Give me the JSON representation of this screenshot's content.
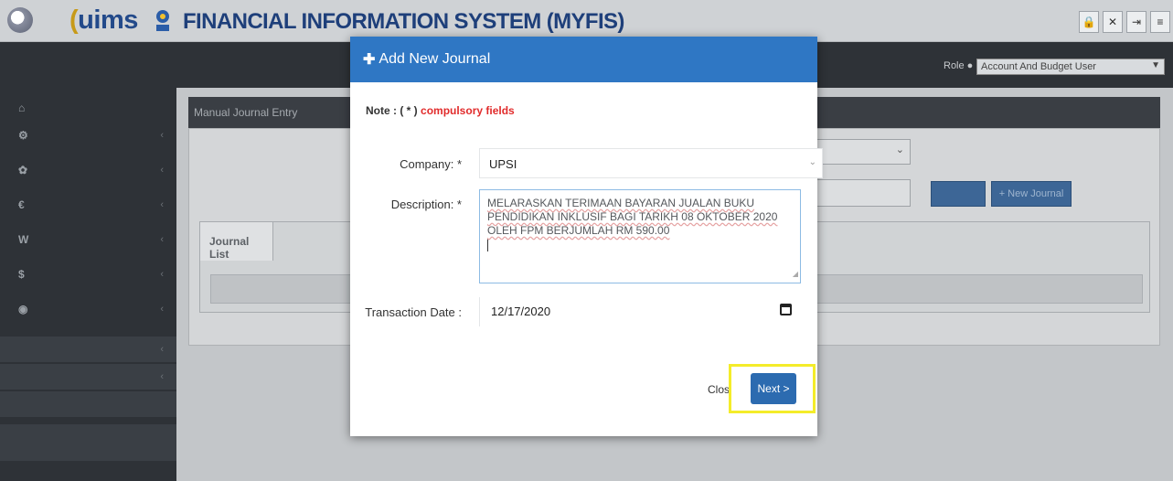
{
  "header": {
    "app_name": "UIMS",
    "title": "FINANCIAL INFORMATION SYSTEM (MYFIS)",
    "buttons": [
      "lock-icon",
      "expand-icon",
      "logout-icon",
      "menu-icon"
    ]
  },
  "navbar": {
    "role_label": "Role",
    "role_value": "Account And Budget User"
  },
  "main": {
    "panel_title": "Manual Journal Entry",
    "tab_label": "Journal List",
    "add_journal_button": "+ New Journal"
  },
  "modal": {
    "title": "Add New Journal",
    "note_prefix": "Note : ( * )",
    "note_emphasis": "compulsory fields",
    "company_label": "Company: *",
    "company_value": "UPSI",
    "description_label": "Description: *",
    "description_value": "MELARASKAN TERIMAAN BAYARAN JUALAN BUKU PENDIDIKAN INKLUSIF BAGI TARIKH 08 OKTOBER 2020 OLEH FPM BERJUMLAH RM 590.00",
    "date_label": "Transaction Date :",
    "date_value": "12/17/2020",
    "close_label": "Clos",
    "next_label": "Next >"
  },
  "colors": {
    "modal_header": "#2f77c4",
    "primary_button": "#2c6bb0",
    "required_text": "#e12b2b",
    "highlight": "#f4ec2a"
  }
}
